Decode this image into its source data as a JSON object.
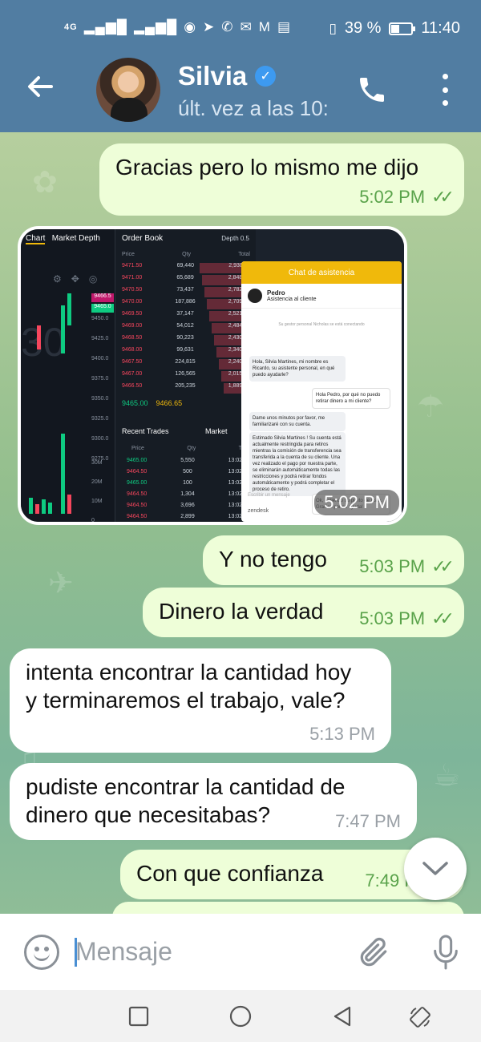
{
  "status_bar": {
    "network": "4G",
    "battery_percent": "39 %",
    "battery_level": 0.39,
    "time": "11:40",
    "icons": [
      "signal-icon",
      "signal-icon",
      "hotspot-icon",
      "telegram-icon",
      "whatsapp-icon",
      "mail-icon",
      "gmail-icon",
      "message-icon",
      "vibrate-icon",
      "battery-icon"
    ]
  },
  "header": {
    "contact_name": "Silvia",
    "last_seen": "últ. vez a las 10:",
    "verified_icon": "verified-badge-icon",
    "back_icon": "back-arrow-icon",
    "call_icon": "phone-icon",
    "menu_icon": "more-vertical-icon"
  },
  "messages": [
    {
      "dir": "out",
      "text": "Gracias pero lo mismo me dijo",
      "time": "5:02 PM",
      "read": true
    },
    {
      "dir": "out",
      "type": "image",
      "time": "5:02 PM"
    },
    {
      "dir": "out",
      "text": "Y no tengo",
      "time": "5:03 PM",
      "read": true
    },
    {
      "dir": "out",
      "text": "Dinero la verdad",
      "time": "5:03 PM",
      "read": true
    },
    {
      "dir": "in",
      "text": "intenta encontrar la cantidad hoy y terminaremos el trabajo, vale?",
      "time": "5:13 PM"
    },
    {
      "dir": "in",
      "text": "pudiste encontrar la cantidad de dinero que necesitabas?",
      "time": "7:47 PM"
    },
    {
      "dir": "out",
      "text": "Con que confianza",
      "time": "7:49 P"
    }
  ],
  "screenshot": {
    "tabs": [
      "Chart",
      "Market Depth"
    ],
    "order_book_title": "Order Book",
    "depth_label": "Depth 0.5",
    "columns": [
      "Price",
      "Qty",
      "Total"
    ],
    "asks": [
      [
        "9471.50",
        "69,440",
        "2,938,11"
      ],
      [
        "9471.00",
        "65,689",
        "2,848,67"
      ],
      [
        "9470.50",
        "73,437",
        "2,782,98"
      ],
      [
        "9470.00",
        "187,886",
        "2,709,55"
      ],
      [
        "9469.50",
        "37,147",
        "2,521,66"
      ],
      [
        "9469.00",
        "54,012",
        "2,484,51"
      ],
      [
        "9468.50",
        "90,223",
        "2,430,50"
      ],
      [
        "9468.00",
        "99,631",
        "2,340,28"
      ],
      [
        "9467.50",
        "224,815",
        "2,240,65"
      ],
      [
        "9467.00",
        "126,565",
        "2,015,83"
      ],
      [
        "9466.50",
        "205,235",
        "1,889,27"
      ]
    ],
    "last_price": "9465.00",
    "mark_price": "9466.65",
    "recent_trades_title": "Recent Trades",
    "market_tab": "Market",
    "trade_columns": [
      "Price",
      "Qty",
      "Tim"
    ],
    "trades": [
      [
        "9465.00",
        "5,550",
        "13:02:5"
      ],
      [
        "9464.50",
        "500",
        "13:02:5"
      ],
      [
        "9465.00",
        "100",
        "13:02:4"
      ],
      [
        "9464.50",
        "1,304",
        "13:02:4"
      ],
      [
        "9464.50",
        "3,696",
        "13:02:4"
      ],
      [
        "9464.50",
        "2,899",
        "13:02:4"
      ]
    ],
    "price_axis": [
      "9450.0",
      "9425.0",
      "9400.0",
      "9375.0",
      "9350.0",
      "9325.0",
      "9300.0",
      "9275.0"
    ],
    "volume_axis": [
      "30M",
      "20M",
      "10M",
      "0"
    ],
    "chat_window": {
      "title": "Chat de asistencia",
      "agent_name": "Pedro",
      "agent_role": "Asistencia al cliente",
      "system_note": "Su gestor personal Nicholas se está conectando",
      "messages": [
        {
          "me": false,
          "text": "Hola, Silvia Martines, mi nombre es Ricardo, su asistente personal, en qué puedo ayudarle?"
        },
        {
          "me": true,
          "text": "Hola Pedro, por qué no puedo retirar dinero a mi cliente?"
        },
        {
          "me": false,
          "text": "Dame unos minutos por favor, me familiarizaré con su cuenta."
        },
        {
          "me": false,
          "text": "Estimado Silvia Martines ! Su cuenta está actualmente restringida para retiros mientras la comisión de transferencia sea transferida a la cuenta de su cliente. Una vez realizado el pago por nuestra parte, se eliminarán automáticamente todas las restricciones y podrá retirar fondos automáticamente y podrá completar el proceso de retiro."
        },
        {
          "me": true,
          "text": "Ok, entiendo su punto de vista. Gracias por su ayuda!"
        }
      ],
      "input_placeholder": "Escribir un mensaje",
      "brand": "zendesk"
    }
  },
  "composer": {
    "placeholder": "Mensaje",
    "emoji_icon": "emoji-icon",
    "attach_icon": "paperclip-icon",
    "mic_icon": "microphone-icon"
  },
  "scroll_button_icon": "chevron-down-icon",
  "nav": [
    "recent-apps-icon",
    "home-icon",
    "back-icon",
    "rotate-icon"
  ],
  "colors": {
    "header": "#517da2",
    "outgoing_bubble": "#eefed8",
    "incoming_bubble": "#ffffff",
    "read_ticks": "#5aa34b"
  }
}
